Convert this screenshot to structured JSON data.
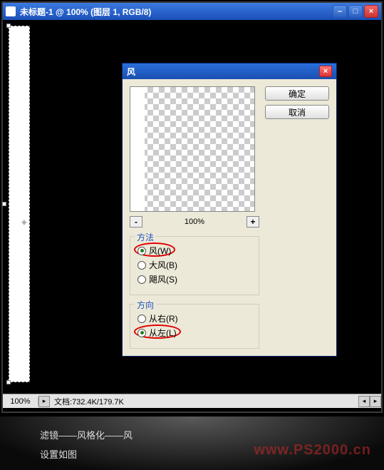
{
  "window": {
    "title": "未标题-1 @ 100% (图层 1, RGB/8)"
  },
  "statusbar": {
    "zoom": "100%",
    "doc_label": "文档:",
    "doc_info": "732.4K/179.7K"
  },
  "dialog": {
    "title": "风",
    "ok_label": "确定",
    "cancel_label": "取消",
    "preview_zoom": "100%",
    "zoom_out": "-",
    "zoom_in": "+",
    "method_group": "方法",
    "method_options": [
      {
        "label": "风(W)",
        "checked": true
      },
      {
        "label": "大风(B)",
        "checked": false
      },
      {
        "label": "飓风(S)",
        "checked": false
      }
    ],
    "direction_group": "方向",
    "direction_options": [
      {
        "label": "从右(R)",
        "checked": false
      },
      {
        "label": "从左(L)",
        "checked": true
      }
    ]
  },
  "caption": {
    "line1": "滤镜——风格化——风",
    "line2": "设置如图"
  },
  "watermark": "www.PS2000.cn"
}
